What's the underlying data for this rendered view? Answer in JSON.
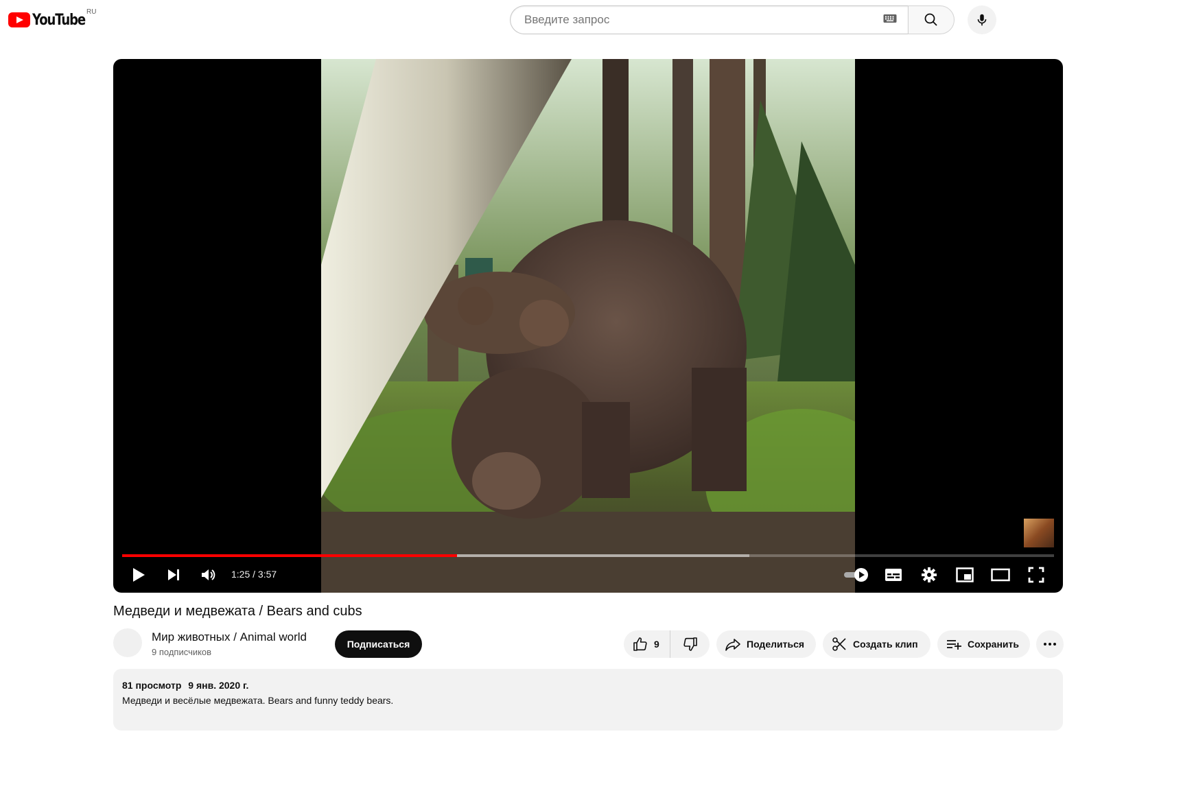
{
  "header": {
    "logo_text": "YouTube",
    "region": "RU",
    "search_placeholder": "Введите запрос"
  },
  "player": {
    "current_time": "1:25",
    "duration": "3:57",
    "time_display": "1:25 / 3:57",
    "progress_played_fraction": 0.359,
    "progress_buffered_fraction": 0.673,
    "autoplay_enabled": true
  },
  "video": {
    "title": "Медведи и медвежата / Bears and cubs",
    "channel_name": "Мир животных / Animal world",
    "subscribers": "9 подписчиков",
    "subscribe_label": "Подписаться",
    "like_count": "9",
    "share_label": "Поделиться",
    "clip_label": "Создать клип",
    "save_label": "Сохранить",
    "views": "81 просмотр",
    "date": "9 янв. 2020 г.",
    "description": "Медведи и весёлые медвежата. Bears and funny teddy bears."
  },
  "colors": {
    "accent": "#ff0000",
    "subscribe_bg": "#0f0f0f",
    "pill_bg": "#f2f2f2"
  },
  "icons": [
    "youtube-logo",
    "keyboard-icon",
    "search-icon",
    "mic-icon",
    "play-icon",
    "next-icon",
    "volume-icon",
    "autoplay-toggle",
    "subtitles-icon",
    "settings-icon",
    "miniplayer-icon",
    "theater-icon",
    "fullscreen-icon",
    "like-icon",
    "dislike-icon",
    "share-icon",
    "clip-icon",
    "save-icon",
    "more-icon"
  ]
}
